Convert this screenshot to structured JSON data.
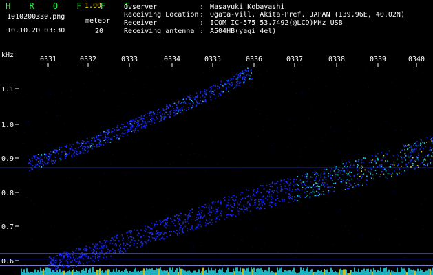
{
  "app": {
    "title": "H R O F F T",
    "version": "1.00"
  },
  "file": {
    "name": "1010200330.png",
    "datetime": "10.10.20 03:30"
  },
  "meteor": {
    "label": "meteor",
    "count": "20"
  },
  "station": {
    "rows": [
      {
        "label": "Ovserver",
        "value": "Masayuki Kobayashi"
      },
      {
        "label": "Receiving Location",
        "value": "Ogata-vill. Akita-Pref. JAPAN (139.96E, 40.02N)"
      },
      {
        "label": "Receiver",
        "value": "ICOM IC-575 53.7492(@LCD)MHz USB"
      },
      {
        "label": "Receiving antenna",
        "value": "A504HB(yagi 4el)"
      }
    ],
    "separator": ":"
  },
  "chart_data": {
    "type": "heatmap",
    "ylabel": "kHz",
    "time_ticks": [
      "0331",
      "0332",
      "0333",
      "0334",
      "0335",
      "0336",
      "0337",
      "0338",
      "0339",
      "0340"
    ],
    "freq_ticks": [
      "1.1",
      "1.0",
      "0.9",
      "0.8",
      "0.7",
      "0.6"
    ],
    "ylim": [
      0.57,
      1.17
    ],
    "grid": false,
    "colors": {
      "background": "#000000",
      "low": "#1a2cff",
      "mid": "#23d0e0",
      "high": "#e8e020",
      "marker_line": "#9aa0ff"
    },
    "traces": [
      {
        "name": "",
        "x": [
          0,
          1,
          2,
          3,
          4,
          5,
          6,
          7,
          8,
          9,
          10
        ],
        "y": [
          0.59,
          0.62,
          0.66,
          0.7,
          0.74,
          0.78,
          0.81,
          0.84,
          0.87,
          0.91,
          0.95
        ]
      },
      {
        "name": "",
        "x": [
          -0.5,
          1,
          2,
          3,
          4,
          5
        ],
        "y": [
          0.88,
          0.94,
          0.99,
          1.04,
          1.09,
          1.15
        ]
      }
    ],
    "horizontal_lines": [
      0.87,
      0.62,
      0.605,
      0.585
    ]
  }
}
